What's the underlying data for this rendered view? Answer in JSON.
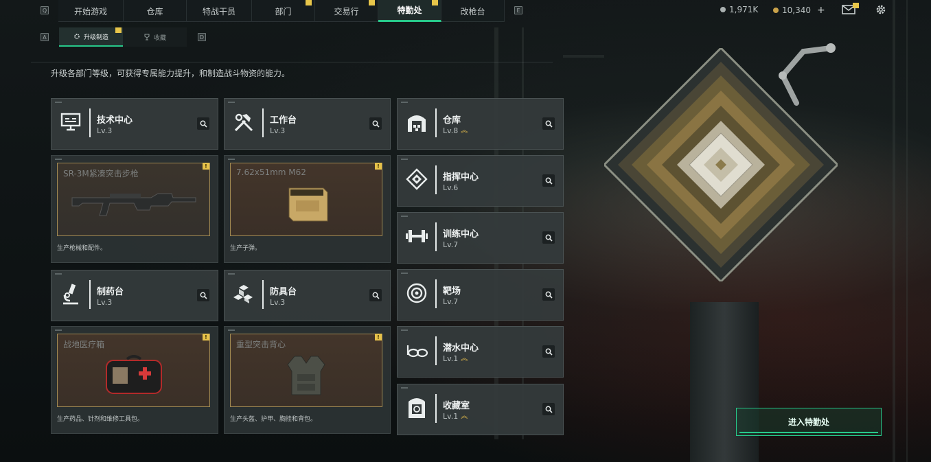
{
  "nav": {
    "hotkey_left": "Q",
    "hotkey_right": "E",
    "tabs": [
      {
        "label": "开始游戏",
        "badge": false
      },
      {
        "label": "仓库",
        "badge": false
      },
      {
        "label": "特战干员",
        "badge": false
      },
      {
        "label": "部门",
        "badge": true
      },
      {
        "label": "交易行",
        "badge": true
      },
      {
        "label": "特勤处",
        "badge": true
      },
      {
        "label": "改枪台",
        "badge": false
      }
    ],
    "active_tab": "特勤处"
  },
  "currency": {
    "silver": "1,971K",
    "gold": "10,340",
    "plus": "+"
  },
  "icons": {
    "mail": "mail-icon",
    "settings": "gear-icon"
  },
  "subtabs": {
    "hotkey_left": "A",
    "hotkey_right": "D",
    "items": [
      {
        "label": "升级制造",
        "badge": true
      },
      {
        "label": "收藏",
        "badge": false
      }
    ]
  },
  "intro": "升级各部门等级，可获得专属能力提升，和制造战斗物资的能力。",
  "workshops": [
    {
      "name": "技术中心",
      "level": "Lv.3",
      "icon": "computer-icon",
      "product": "SR-3M紧凑突击步枪",
      "desc": "生产枪械和配件。",
      "warn": "!"
    },
    {
      "name": "工作台",
      "level": "Lv.3",
      "icon": "tools-icon",
      "product": "7.62x51mm M62",
      "desc": "生产子弹。",
      "warn": "!"
    },
    {
      "name": "制药台",
      "level": "Lv.3",
      "icon": "microscope-icon",
      "product": "战地医疗箱",
      "desc": "生产药品、针剂和维修工具包。",
      "warn": "!"
    },
    {
      "name": "防具台",
      "level": "Lv.3",
      "icon": "blocks-icon",
      "product": "重型突击背心",
      "desc": "生产头盔、护甲、胸挂和背包。",
      "warn": "!"
    }
  ],
  "facilities": [
    {
      "name": "仓库",
      "level": "Lv.8",
      "icon": "warehouse-icon",
      "upgrade": true
    },
    {
      "name": "指挥中心",
      "level": "Lv.6",
      "icon": "command-icon",
      "upgrade": false
    },
    {
      "name": "训练中心",
      "level": "Lv.7",
      "icon": "dumbbell-icon",
      "upgrade": false
    },
    {
      "name": "靶场",
      "level": "Lv.7",
      "icon": "target-icon",
      "upgrade": false
    },
    {
      "name": "潜水中心",
      "level": "Lv.1",
      "icon": "goggles-icon",
      "upgrade": true
    },
    {
      "name": "收藏室",
      "level": "Lv.1",
      "icon": "vault-icon",
      "upgrade": true
    }
  ],
  "enter_button": "进入特勤处",
  "colors": {
    "accent": "#27c88a",
    "badge": "#e8c64a",
    "upgrade": "#e0b84a",
    "product_border": "#a28a52"
  }
}
